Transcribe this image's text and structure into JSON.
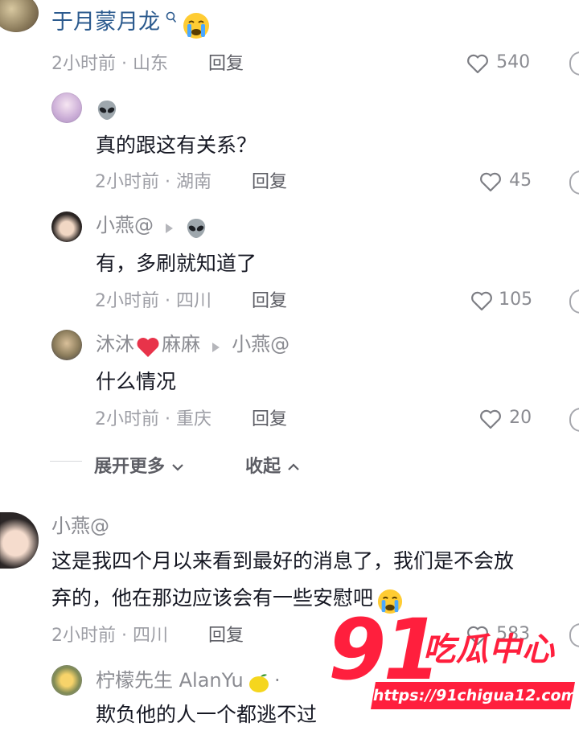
{
  "colors": {
    "accent": "#2b5a8e",
    "watermark": "#ff1f3d",
    "heart": "#e8334a"
  },
  "top_comment": {
    "author": "于月蒙月龙",
    "meta": "2小时前 · 山东",
    "reply": "回复",
    "likes": "540"
  },
  "replies": [
    {
      "author": "",
      "text": "真的跟这有关系？",
      "meta": "2小时前 · 湖南",
      "reply": "回复",
      "likes": "45"
    },
    {
      "author": "小燕@",
      "text": "有，多刷就知道了",
      "meta": "2小时前 · 四川",
      "reply": "回复",
      "likes": "105"
    },
    {
      "author_a": "沐沐",
      "author_b": "麻麻",
      "reply_to": "小燕@",
      "text": "什么情况",
      "meta": "2小时前 · 重庆",
      "reply": "回复",
      "likes": "20"
    }
  ],
  "thread_controls": {
    "expand": "展开更多",
    "collapse": "收起"
  },
  "second_comment": {
    "author": "小燕@",
    "text_line1": "这是我四个月以来看到最好的消息了，我们是不会放",
    "text_line2": "弃的，他在那边应该会有一些安慰吧",
    "meta": "2小时前 · 四川",
    "reply": "回复",
    "likes": "583"
  },
  "second_reply": {
    "author": "柠檬先生 AlanYu",
    "text": "欺负他的人一个都逃不过"
  },
  "watermark": {
    "logo_number": "91",
    "logo_text": "吃瓜中心",
    "url": "https://91chigua12.com"
  }
}
